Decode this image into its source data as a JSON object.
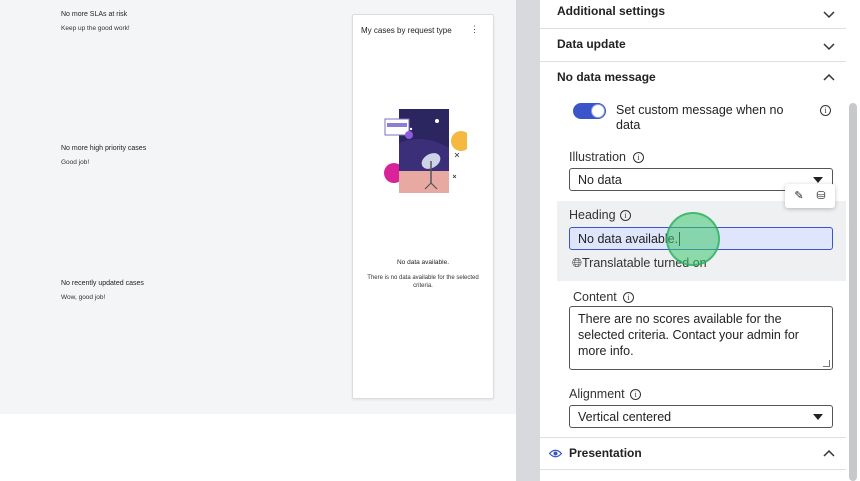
{
  "canvas": {
    "widgets": [
      {
        "title": "No more SLAs at risk",
        "subtitle": "Keep up the good work!"
      },
      {
        "title": "No more high priority cases",
        "subtitle": "Good job!"
      },
      {
        "title": "No recently updated cases",
        "subtitle": "Wow, good job!"
      }
    ],
    "card": {
      "title": "My cases by request type",
      "menu_icon": "kebab-menu-icon",
      "heading": "No data available.",
      "content": "There is no data available for the selected criteria."
    }
  },
  "panel": {
    "sections": {
      "additional_settings": "Additional settings",
      "data_update": "Data update",
      "no_data_message": "No data message",
      "presentation": "Presentation"
    },
    "toggle": {
      "label": "Set custom message when no data",
      "on": true
    },
    "illustration": {
      "label": "Illustration",
      "value": "No data"
    },
    "heading": {
      "label": "Heading",
      "value": "No data available."
    },
    "translatable": "Translatable turned on",
    "content": {
      "label": "Content",
      "value": "There are no scores available for the selected criteria. Contact your admin for more info."
    },
    "alignment": {
      "label": "Alignment",
      "value": "Vertical centered"
    }
  },
  "colors": {
    "accent": "#3a55c9",
    "canvas_bg": "#f4f5f7",
    "touch_indicator": "#3cc86e"
  }
}
